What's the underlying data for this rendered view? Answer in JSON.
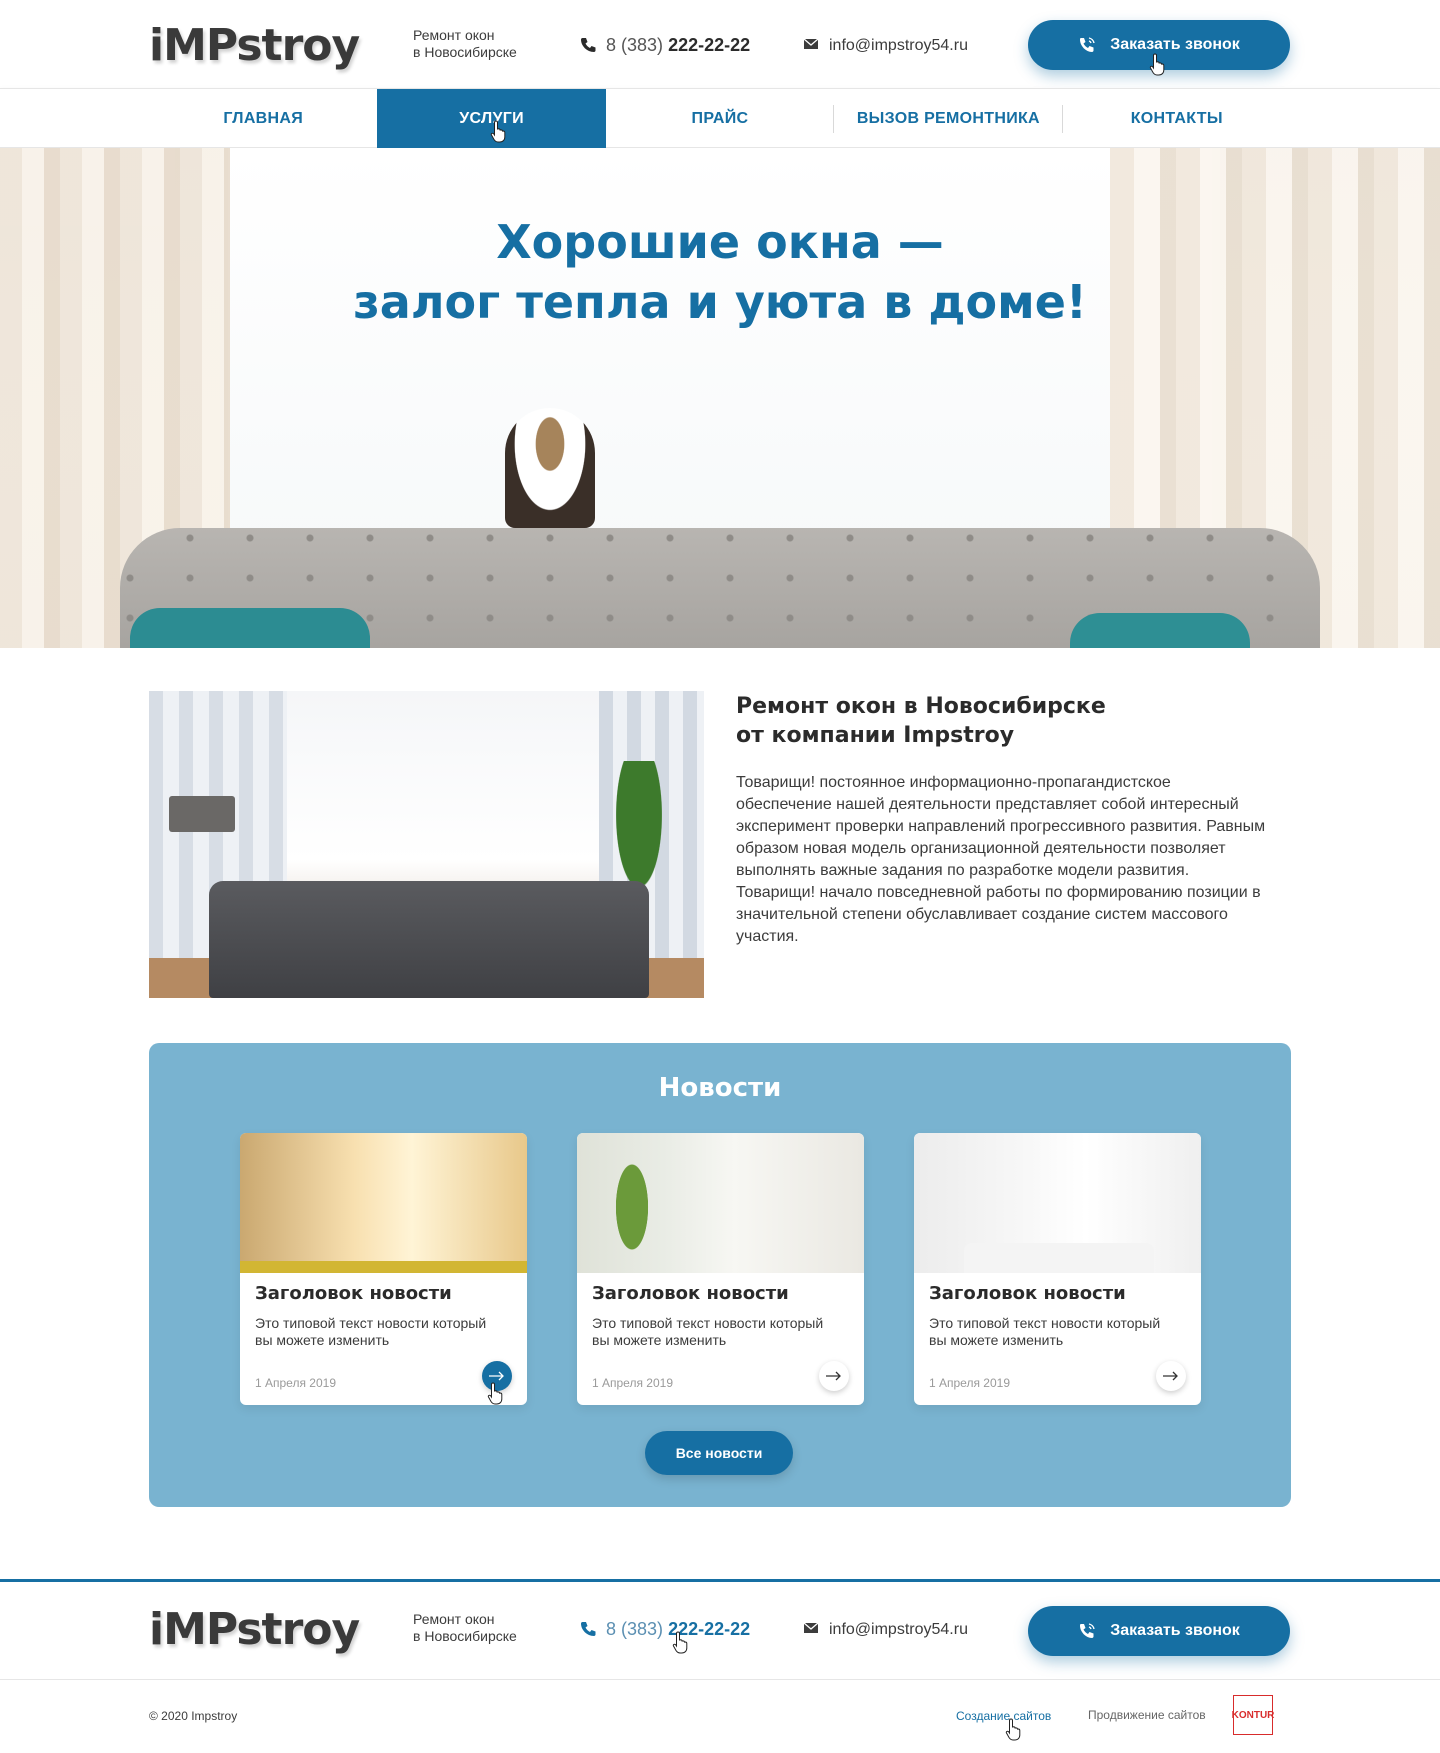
{
  "colors": {
    "accent": "#166fa3",
    "news_bg": "#79b3d0",
    "text": "#2b2b2b"
  },
  "header": {
    "logo": "iMPstroy",
    "tagline_line1": "Ремонт окон",
    "tagline_line2": "в Новосибирске",
    "phone_code": "8 (383)",
    "phone_number": "222-22-22",
    "email": "info@impstroy54.ru",
    "call_button": "Заказать звонок",
    "icons": {
      "phone": "phone-icon",
      "mail": "mail-icon",
      "call": "phone-call-icon"
    }
  },
  "nav": {
    "items": [
      {
        "label": "ГЛАВНАЯ"
      },
      {
        "label": "УСЛУГИ"
      },
      {
        "label": "ПРАЙС"
      },
      {
        "label": "ВЫЗОВ РЕМОНТНИКА"
      },
      {
        "label": "КОНТАКТЫ"
      }
    ],
    "active_index": 1
  },
  "hero": {
    "title_line1": "Хорошие окна —",
    "title_line2": "залог тепла и уюта в доме!"
  },
  "about": {
    "title_line1": "Ремонт окон в Новосибирске",
    "title_line2": "от компании Impstroy",
    "text": "Товарищи! постоянное информационно-пропагандистское обеспечение нашей деятельности представляет собой интересный эксперимент проверки направлений прогрессивного развития. Равным образом новая модель организационной деятельности позволяет выполнять важные задания по разработке модели развития. Товарищи! начало повседневной работы по формированию позиции в значительной степени обуславливает создание систем массового участия."
  },
  "news": {
    "title": "Новости",
    "cards": [
      {
        "title": "Заголовок новости",
        "text": "Это типовой текст новости который вы можете изменить",
        "date": "1 Апреля 2019"
      },
      {
        "title": "Заголовок новости",
        "text": "Это типовой текст новости который вы можете изменить",
        "date": "1 Апреля 2019"
      },
      {
        "title": "Заголовок новости",
        "text": "Это типовой текст новости который вы можете изменить",
        "date": "1 Апреля 2019"
      }
    ],
    "all_button": "Все новости"
  },
  "footer": {
    "logo": "iMPstroy",
    "tagline_line1": "Ремонт окон",
    "tagline_line2": "в Новосибирске",
    "phone_code": "8 (383)",
    "phone_number": "222-22-22",
    "email": "info@impstroy54.ru",
    "call_button": "Заказать звонок",
    "copyright": "© 2020 Impstroy",
    "link_sites": "Создание сайтов",
    "link_seo": "Продвижение сайтов",
    "kontur": "KONTUR"
  }
}
